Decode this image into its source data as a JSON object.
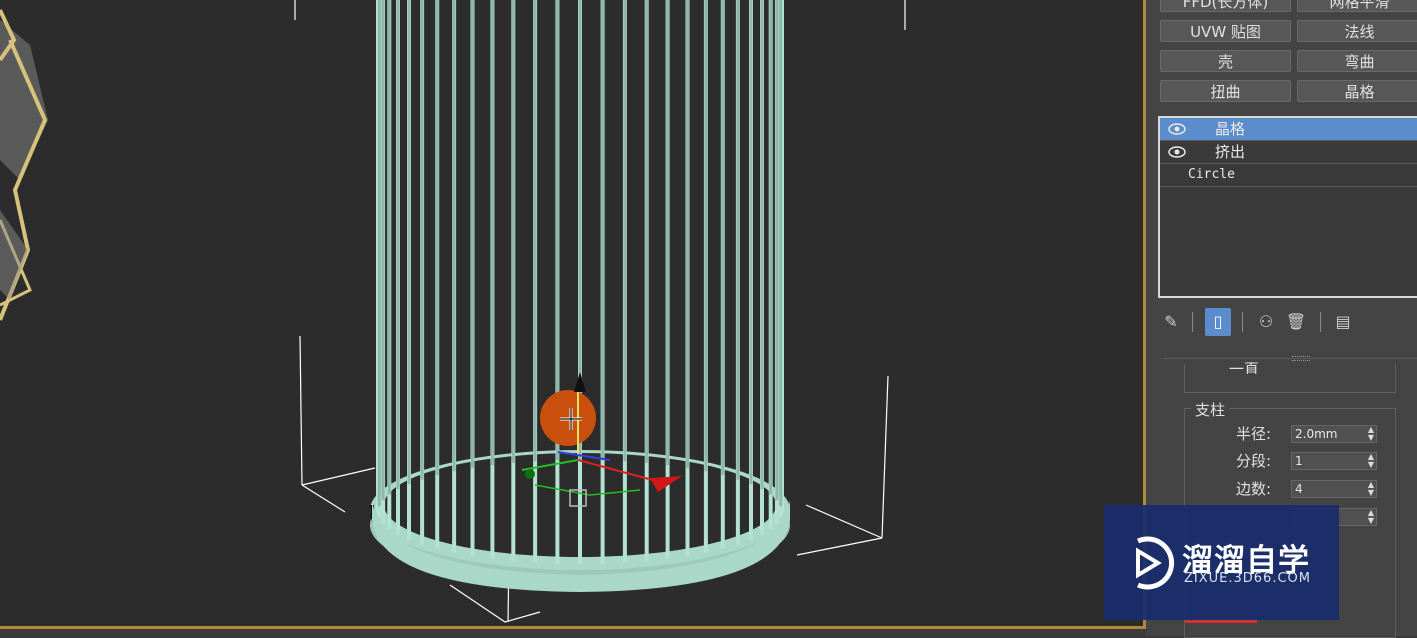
{
  "modifier_buttons": [
    {
      "label": "FFD(长方体)"
    },
    {
      "label": "网格平滑"
    },
    {
      "label": "UVW 贴图"
    },
    {
      "label": "法线"
    },
    {
      "label": "壳"
    },
    {
      "label": "弯曲"
    },
    {
      "label": "扭曲"
    },
    {
      "label": "晶格"
    }
  ],
  "modifier_stack": [
    {
      "label": "晶格",
      "selected": true,
      "visible_icon": "eye-icon"
    },
    {
      "label": "挤出",
      "selected": false,
      "visible_icon": "eye-icon"
    },
    {
      "label": "Circle",
      "selected": false
    }
  ],
  "stack_tools": [
    {
      "icon": "pin-stack-icon"
    },
    {
      "icon": "show-end-result-icon",
      "active": true
    },
    {
      "icon": "make-unique-icon"
    },
    {
      "icon": "remove-modifier-icon"
    },
    {
      "icon": "configure-modifier-sets-icon"
    }
  ],
  "prev_group_fragment": "一直",
  "strut_group": {
    "title": "支柱",
    "params": [
      {
        "label": "半径:",
        "value": "2.0mm"
      },
      {
        "label": "分段:",
        "value": "1"
      },
      {
        "label": "边数:",
        "value": "4"
      },
      {
        "label": "",
        "value": ""
      }
    ]
  },
  "watermark": {
    "brand": "溜溜自学",
    "url": "ZIXUE.3D66.COM"
  },
  "colors": {
    "accent_selected": "#5b8ccc",
    "viewport_border": "#b08a3a",
    "cage": "#a9d8c8",
    "gizmo": "#c8500c"
  }
}
